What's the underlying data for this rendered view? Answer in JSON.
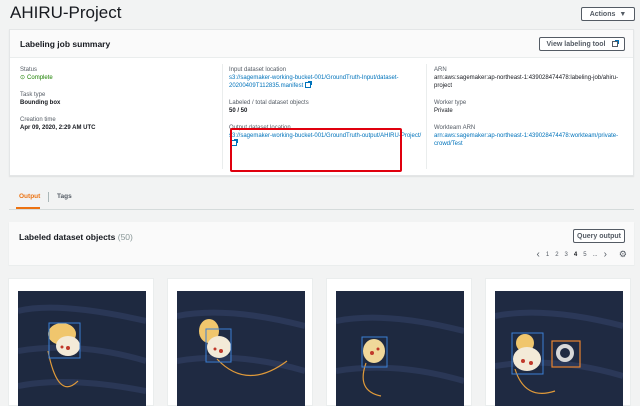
{
  "page": {
    "title": "AHIRU-Project",
    "actions_label": "Actions"
  },
  "summary": {
    "heading": "Labeling job summary",
    "view_tool_label": "View labeling tool",
    "status_label": "Status",
    "status_value": "Complete",
    "task_type_label": "Task type",
    "task_type_value": "Bounding box",
    "creation_time_label": "Creation time",
    "creation_time_value": "Apr 09, 2020, 2:29 AM UTC",
    "input_location_label": "Input dataset location",
    "input_location_value": "s3://sagemaker-working-bucket-001/GroundTruth-Input/dataset-20200409T112835.manifest",
    "labeled_total_label": "Labeled / total dataset objects",
    "labeled_total_value": "50 / 50",
    "output_location_label": "Output dataset location",
    "output_location_value": "s3://sagemaker-working-bucket-001/GroundTruth-output/AHIRU-Project/",
    "arn_label": "ARN",
    "arn_value": "arn:aws:sagemaker:ap-northeast-1:439028474478:labeling-job/ahiru-project",
    "worker_type_label": "Worker type",
    "worker_type_value": "Private",
    "workteam_arn_label": "Workteam ARN",
    "workteam_arn_value": "arn:aws:sagemaker:ap-northeast-1:439028474478:workteam/private-crowd/Test"
  },
  "tabs": [
    {
      "label": "Output",
      "active": true
    },
    {
      "label": "Tags",
      "active": false
    }
  ],
  "objects": {
    "heading": "Labeled dataset objects",
    "count": "(50)",
    "query_label": "Query output",
    "pages": [
      "1",
      "2",
      "3",
      "4",
      "5",
      "...",
      ""
    ],
    "current_page": "4"
  },
  "colors": {
    "accent": "#ec7211",
    "link": "#0073bb",
    "success": "#1d8102",
    "highlight": "#e0000e",
    "box_blue": "#3b7fd4",
    "box_orange": "#e8832e"
  },
  "icons": {
    "external_link": "external-link-icon",
    "status": "check-circle-icon",
    "caret": "caret-down-icon",
    "pager_prev": "chevron-left-icon",
    "pager_next": "chevron-right-icon",
    "settings": "gear-icon"
  }
}
